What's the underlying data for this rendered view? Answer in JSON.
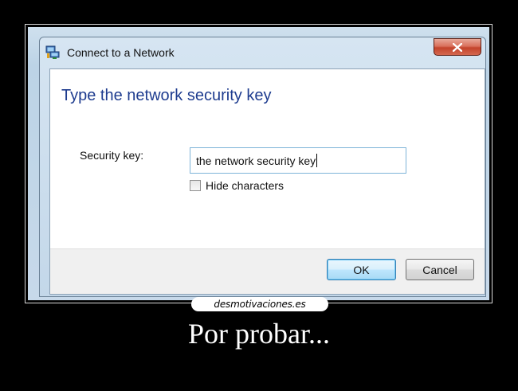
{
  "window": {
    "title": "Connect to a Network",
    "close_glyph": "x"
  },
  "dialog": {
    "heading": "Type the network security key",
    "security_key_label": "Security key:",
    "security_key_value": "the network security key",
    "hide_characters_label": "Hide characters",
    "hide_characters_checked": false,
    "ok_label": "OK",
    "cancel_label": "Cancel"
  },
  "poster": {
    "site": "desmotivaciones.es",
    "caption": "Por probar..."
  },
  "icons": {
    "title_icon": "network-icon",
    "close_icon": "close-icon"
  },
  "colors": {
    "heading": "#1e3c8f",
    "close_button": "#c3432b",
    "background": "#000000"
  }
}
